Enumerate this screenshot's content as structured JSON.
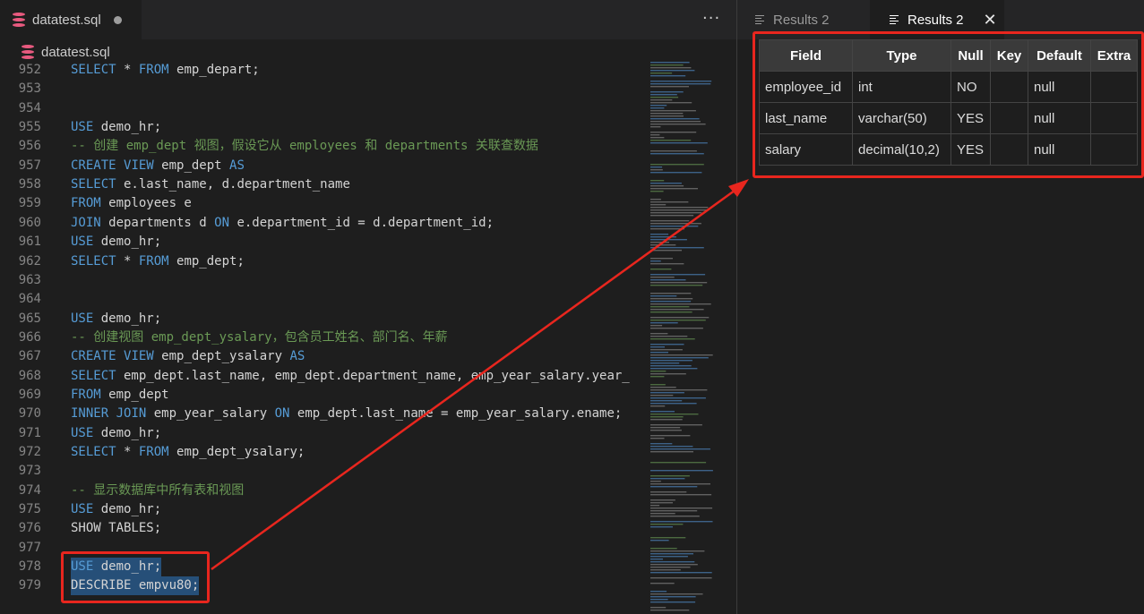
{
  "editor": {
    "tab_label": "datatest.sql",
    "breadcrumb": "datatest.sql",
    "more": "···",
    "lines": [
      {
        "n": "952",
        "t": "SELECT * FROM emp_depart;",
        "c": "#d4d4d4"
      },
      {
        "n": "953",
        "t": "",
        "c": ""
      },
      {
        "n": "954",
        "t": "",
        "c": ""
      },
      {
        "n": "955",
        "t": "USE demo_hr;",
        "c": "#d4d4d4"
      },
      {
        "n": "956",
        "t": "-- 创建 emp_dept 视图，假设它从 employees 和 departments 关联查数据",
        "c": "#6a9955"
      },
      {
        "n": "957",
        "t": "CREATE VIEW emp_dept AS",
        "c": "#d4d4d4"
      },
      {
        "n": "958",
        "t": "SELECT e.last_name, d.department_name",
        "c": "#d4d4d4"
      },
      {
        "n": "959",
        "t": "FROM employees e",
        "c": "#d4d4d4"
      },
      {
        "n": "960",
        "t": "JOIN departments d ON e.department_id = d.department_id;",
        "c": "#d4d4d4"
      },
      {
        "n": "961",
        "t": "USE demo_hr;",
        "c": "#d4d4d4"
      },
      {
        "n": "962",
        "t": "SELECT * FROM emp_dept;",
        "c": "#d4d4d4"
      },
      {
        "n": "963",
        "t": "",
        "c": ""
      },
      {
        "n": "964",
        "t": "",
        "c": ""
      },
      {
        "n": "965",
        "t": "USE demo_hr;",
        "c": "#d4d4d4"
      },
      {
        "n": "966",
        "t": "-- 创建视图 emp_dept_ysalary，包含员工姓名、部门名、年薪",
        "c": "#6a9955"
      },
      {
        "n": "967",
        "t": "CREATE VIEW emp_dept_ysalary AS",
        "c": "#d4d4d4"
      },
      {
        "n": "968",
        "t": "SELECT emp_dept.last_name, emp_dept.department_name, emp_year_salary.year_",
        "c": "#d4d4d4"
      },
      {
        "n": "969",
        "t": "FROM emp_dept",
        "c": "#d4d4d4"
      },
      {
        "n": "970",
        "t": "INNER JOIN emp_year_salary ON emp_dept.last_name = emp_year_salary.ename;",
        "c": "#d4d4d4"
      },
      {
        "n": "971",
        "t": "USE demo_hr;",
        "c": "#d4d4d4"
      },
      {
        "n": "972",
        "t": "SELECT * FROM emp_dept_ysalary;",
        "c": "#d4d4d4"
      },
      {
        "n": "973",
        "t": "",
        "c": ""
      },
      {
        "n": "974",
        "t": "-- 显示数据库中所有表和视图",
        "c": "#6a9955"
      },
      {
        "n": "975",
        "t": "USE demo_hr;",
        "c": "#d4d4d4"
      },
      {
        "n": "976",
        "t": "SHOW TABLES;",
        "c": "#d4d4d4"
      },
      {
        "n": "977",
        "t": "",
        "c": ""
      },
      {
        "n": "978",
        "t": "USE demo_hr;",
        "c": "#d4d4d4"
      },
      {
        "n": "979",
        "t": "DESCRIBE empvu80;",
        "c": "#d4d4d4"
      }
    ]
  },
  "results": {
    "tabs": [
      "Results 2",
      "Results 2"
    ],
    "close": "✕",
    "columns": [
      "Field",
      "Type",
      "Null",
      "Key",
      "Default",
      "Extra"
    ],
    "rows": [
      [
        "employee_id",
        "int",
        "NO",
        "",
        "null",
        ""
      ],
      [
        "last_name",
        "varchar(50)",
        "YES",
        "",
        "null",
        ""
      ],
      [
        "salary",
        "decimal(10,2)",
        "YES",
        "",
        "null",
        ""
      ]
    ]
  },
  "colors": {
    "accent_red": "#e8261e",
    "keyword": "#569cd6",
    "comment": "#6a9955",
    "db_icon": "#e85a7f",
    "selection": "#264f78"
  }
}
